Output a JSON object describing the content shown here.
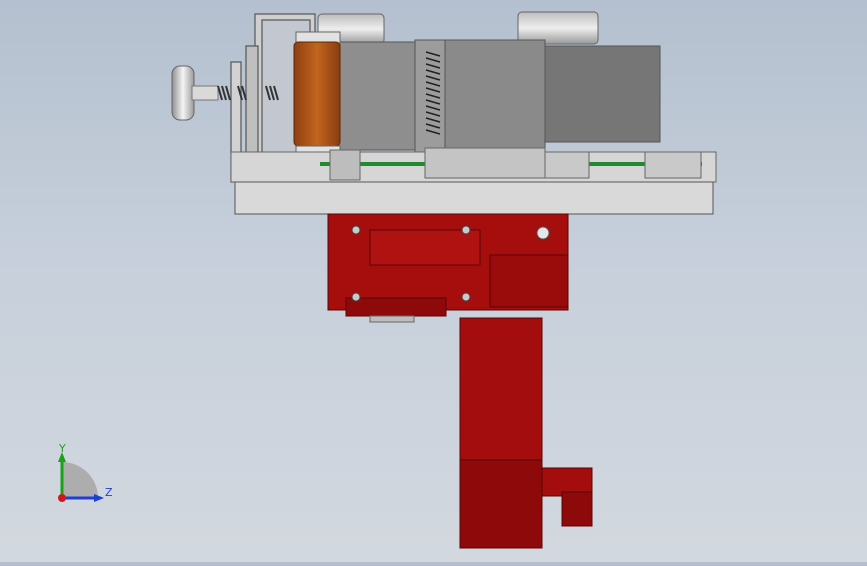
{
  "view": {
    "background_top": "#b4c0cf",
    "background_bottom": "#d3d8df",
    "model_colors": {
      "frame": "#d9d9d9",
      "frame_edge": "#5a5a5a",
      "housing": "#8a8a8a",
      "housing_dark": "#767676",
      "roller": "#b0561c",
      "belt": "#1f8a2e",
      "motor": "#a80d0d",
      "motor_dark": "#7a0808",
      "knob": "#e0e0e0"
    },
    "icons": [
      "coordinate-triad-icon",
      "knob-icon",
      "spring-icon",
      "roller-icon",
      "motor-icon"
    ]
  },
  "triad": {
    "y_label": "Y",
    "z_label": "Z",
    "colors": {
      "y": "#1aa31a",
      "z": "#1e3fd6",
      "origin": "#d01818"
    }
  }
}
